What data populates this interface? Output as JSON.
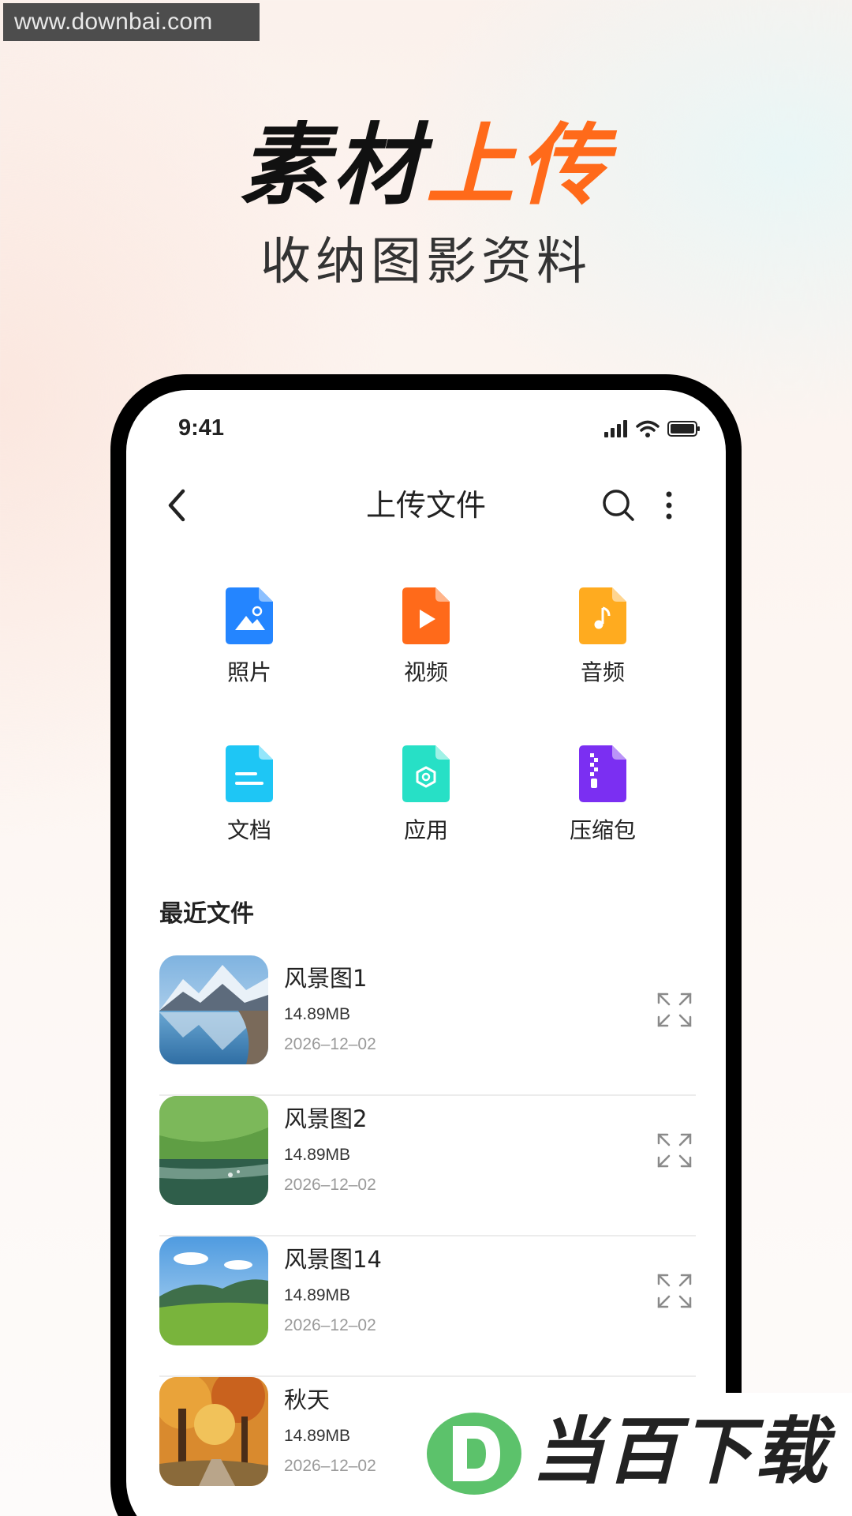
{
  "watermark": {
    "url_text": "www.downbai.com",
    "logo_text": "当百下载",
    "logo_letter": "D"
  },
  "headline": {
    "part1": "素材",
    "part2": "上传",
    "subtitle": "收纳图影资料"
  },
  "status_bar": {
    "time": "9:41"
  },
  "nav": {
    "title": "上传文件"
  },
  "categories": [
    {
      "label": "照片",
      "icon": "image-file-icon",
      "color": "#2485ff"
    },
    {
      "label": "视频",
      "icon": "video-file-icon",
      "color": "#ff6a1a"
    },
    {
      "label": "音频",
      "icon": "audio-file-icon",
      "color": "#ffab1f"
    },
    {
      "label": "文档",
      "icon": "document-file-icon",
      "color": "#1ec6f5"
    },
    {
      "label": "应用",
      "icon": "app-file-icon",
      "color": "#27e0c6"
    },
    {
      "label": "压缩包",
      "icon": "zip-file-icon",
      "color": "#7b2ff2"
    }
  ],
  "recent": {
    "title": "最近文件",
    "files": [
      {
        "name": "风景图1",
        "size": "14.89MB",
        "date": "2026–12–02",
        "thumb": "mountain-lake-thumbnail"
      },
      {
        "name": "风景图2",
        "size": "14.89MB",
        "date": "2026–12–02",
        "thumb": "green-meadow-lake-thumbnail"
      },
      {
        "name": "风景图14",
        "size": "14.89MB",
        "date": "2026–12–02",
        "thumb": "green-hills-sky-thumbnail"
      },
      {
        "name": "秋天",
        "size": "14.89MB",
        "date": "2026–12–02",
        "thumb": "autumn-trees-thumbnail"
      }
    ]
  },
  "colors": {
    "accent_orange": "#ff6a1a",
    "logo_green": "#5cc26b"
  }
}
